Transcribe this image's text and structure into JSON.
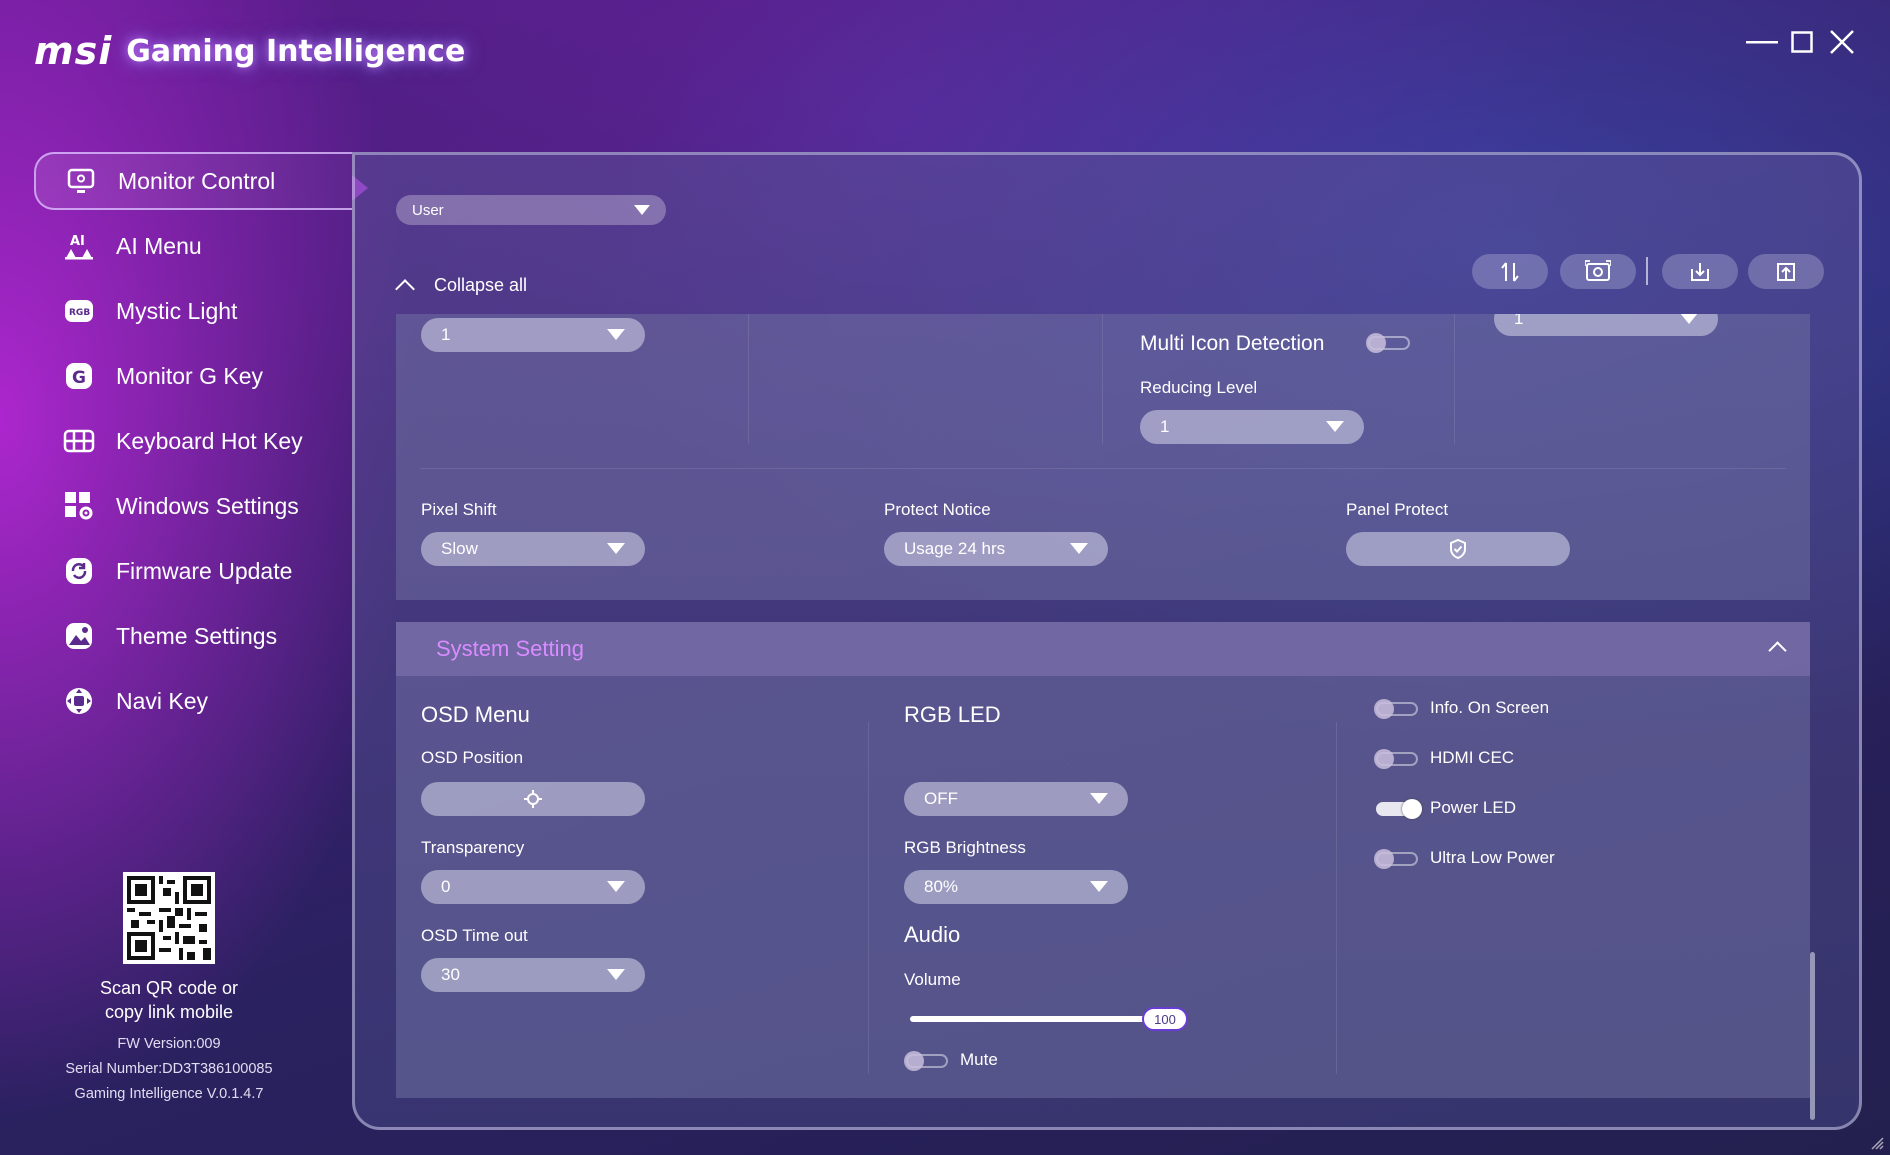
{
  "app": {
    "logo_text": "msi",
    "title": "Gaming Intelligence"
  },
  "window_controls": [
    "minimize-icon",
    "maximize-icon",
    "close-icon"
  ],
  "sidebar": {
    "items": [
      {
        "label": "Monitor Control",
        "icon": "monitor-icon",
        "active": true
      },
      {
        "label": "AI Menu",
        "icon": "ai-icon"
      },
      {
        "label": "Mystic Light",
        "icon": "rgb-icon"
      },
      {
        "label": "Monitor G Key",
        "icon": "g-key-icon"
      },
      {
        "label": "Keyboard Hot Key",
        "icon": "keyboard-icon"
      },
      {
        "label": "Windows Settings",
        "icon": "windows-settings-icon"
      },
      {
        "label": "Firmware Update",
        "icon": "firmware-icon"
      },
      {
        "label": "Theme Settings",
        "icon": "theme-icon"
      },
      {
        "label": "Navi Key",
        "icon": "navi-key-icon"
      }
    ],
    "qr_caption_1": "Scan QR code or",
    "qr_caption_2": "copy link mobile",
    "fw_version": "FW Version:009",
    "serial": "Serial Number:DD3T386100085",
    "app_version": "Gaming Intelligence V.0.1.4.7"
  },
  "main": {
    "profile": "User",
    "collapse_all": "Collapse all",
    "toolbar_icons": [
      "sort-icon",
      "screenshot-icon",
      "import-icon",
      "export-icon"
    ],
    "top_section": {
      "dropdown_1": "1",
      "multi_icon_detection_label": "Multi Icon Detection",
      "multi_icon_detection_on": false,
      "reducing_level_label": "Reducing Level",
      "reducing_level_value": "1",
      "dropdown_right": "1",
      "pixel_shift_label": "Pixel Shift",
      "pixel_shift_value": "Slow",
      "protect_notice_label": "Protect Notice",
      "protect_notice_value": "Usage 24 hrs",
      "panel_protect_label": "Panel Protect"
    },
    "system_setting": {
      "title": "System Setting",
      "osd_menu": "OSD Menu",
      "osd_position": "OSD Position",
      "transparency_label": "Transparency",
      "transparency_value": "0",
      "osd_timeout_label": "OSD Time out",
      "osd_timeout_value": "30",
      "rgb_led": "RGB LED",
      "rgb_led_value": "OFF",
      "rgb_brightness_label": "RGB Brightness",
      "rgb_brightness_value": "80%",
      "audio": "Audio",
      "volume_label": "Volume",
      "volume_value": "100",
      "volume_fraction": 1.0,
      "mute_label": "Mute",
      "mute_on": false,
      "toggles": [
        {
          "label": "Info. On Screen",
          "on": false
        },
        {
          "label": "HDMI CEC",
          "on": false
        },
        {
          "label": "Power LED",
          "on": true
        },
        {
          "label": "Ultra Low Power",
          "on": false
        }
      ]
    }
  }
}
